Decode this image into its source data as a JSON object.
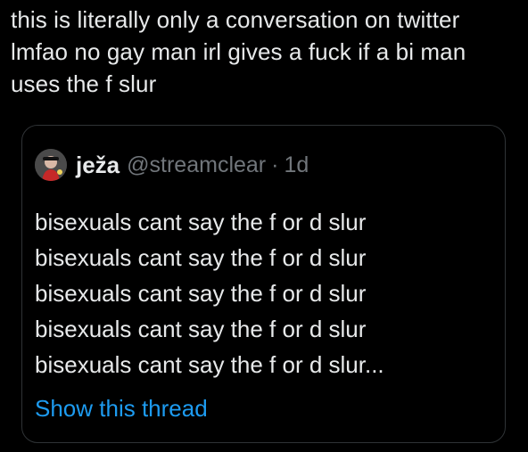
{
  "tweet": {
    "text": "this is literally only a conversation on twitter lmfao no gay man irl gives a fuck if a bi man uses the f slur"
  },
  "quote": {
    "author": {
      "display_name": "ježa",
      "handle": "@streamclear",
      "separator": "·",
      "time": "1d"
    },
    "lines": [
      "bisexuals cant say the f or d slur",
      "bisexuals cant say the f or d slur",
      "bisexuals cant say the f or d slur",
      "bisexuals cant say the f or d slur",
      "bisexuals cant say the f or d slur..."
    ],
    "show_thread_label": "Show this thread"
  },
  "colors": {
    "background": "#000000",
    "text": "#e7e9ea",
    "secondary_text": "#71767b",
    "link": "#1d9bf0",
    "border": "#2f3336"
  },
  "icons": {
    "avatar": "avatar"
  }
}
